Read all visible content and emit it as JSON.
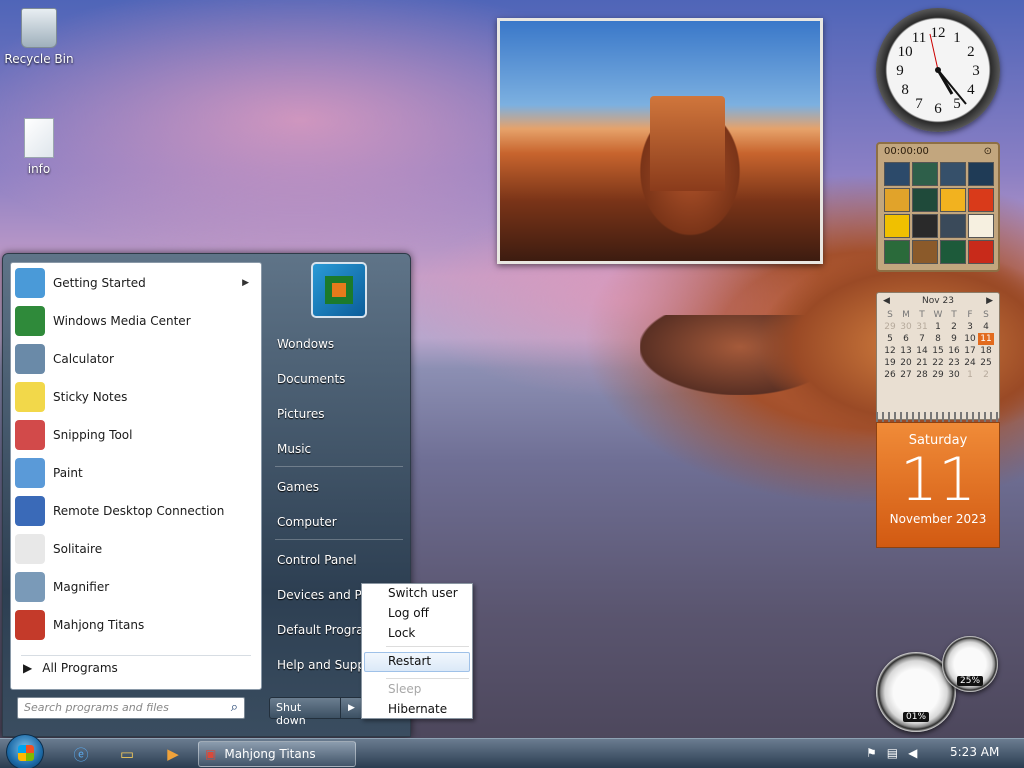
{
  "desktop": {
    "icons": [
      {
        "label": "Recycle Bin",
        "icon": "recycle-bin-icon"
      },
      {
        "label": "info",
        "icon": "text-document-icon"
      }
    ]
  },
  "gadgets": {
    "clock": {
      "numerals": [
        "12",
        "1",
        "2",
        "3",
        "4",
        "5",
        "6",
        "7",
        "8",
        "9",
        "10",
        "11"
      ]
    },
    "puzzle": {
      "timer": "00:00:00"
    },
    "calendar": {
      "month_label": "Nov 23",
      "weekdays": [
        "S",
        "M",
        "T",
        "W",
        "T",
        "F",
        "S"
      ],
      "weeks": [
        [
          "29",
          "30",
          "31",
          "1",
          "2",
          "3",
          "4"
        ],
        [
          "5",
          "6",
          "7",
          "8",
          "9",
          "10",
          "11"
        ],
        [
          "12",
          "13",
          "14",
          "15",
          "16",
          "17",
          "18"
        ],
        [
          "19",
          "20",
          "21",
          "22",
          "23",
          "24",
          "25"
        ],
        [
          "26",
          "27",
          "28",
          "29",
          "30",
          "1",
          "2"
        ]
      ],
      "day_of_week": "Saturday",
      "day_number": "11",
      "month_year": "November 2023"
    },
    "cpu_meter": {
      "cpu": "01%",
      "memory": "25%"
    }
  },
  "start_menu": {
    "programs": [
      {
        "label": "Getting Started",
        "icon": "getting-started-icon",
        "has_submenu": true
      },
      {
        "label": "Windows Media Center",
        "icon": "media-center-icon"
      },
      {
        "label": "Calculator",
        "icon": "calculator-icon"
      },
      {
        "label": "Sticky Notes",
        "icon": "sticky-notes-icon"
      },
      {
        "label": "Snipping Tool",
        "icon": "snipping-tool-icon"
      },
      {
        "label": "Paint",
        "icon": "paint-icon"
      },
      {
        "label": "Remote Desktop Connection",
        "icon": "remote-desktop-icon"
      },
      {
        "label": "Solitaire",
        "icon": "solitaire-icon"
      },
      {
        "label": "Magnifier",
        "icon": "magnifier-icon"
      },
      {
        "label": "Mahjong Titans",
        "icon": "mahjong-icon"
      }
    ],
    "all_programs": "All Programs",
    "search_placeholder": "Search programs and files",
    "right_items": [
      "Wondows",
      "Documents",
      "Pictures",
      "Music",
      "Games",
      "Computer",
      "Control Panel",
      "Devices and Printers",
      "Default Programs",
      "Help and Support"
    ],
    "shutdown_label": "Shut down"
  },
  "power_menu": {
    "items": [
      "Switch user",
      "Log off",
      "Lock",
      "Restart",
      "Sleep",
      "Hibernate"
    ],
    "highlighted": "Restart",
    "disabled": [
      "Sleep"
    ]
  },
  "taskbar": {
    "running_app": "Mahjong Titans",
    "time": "5:23 AM"
  },
  "colors": {
    "today": "#e26b1e",
    "taskbar": "#3c5063",
    "menu_highlight": "#dbe9f8"
  }
}
